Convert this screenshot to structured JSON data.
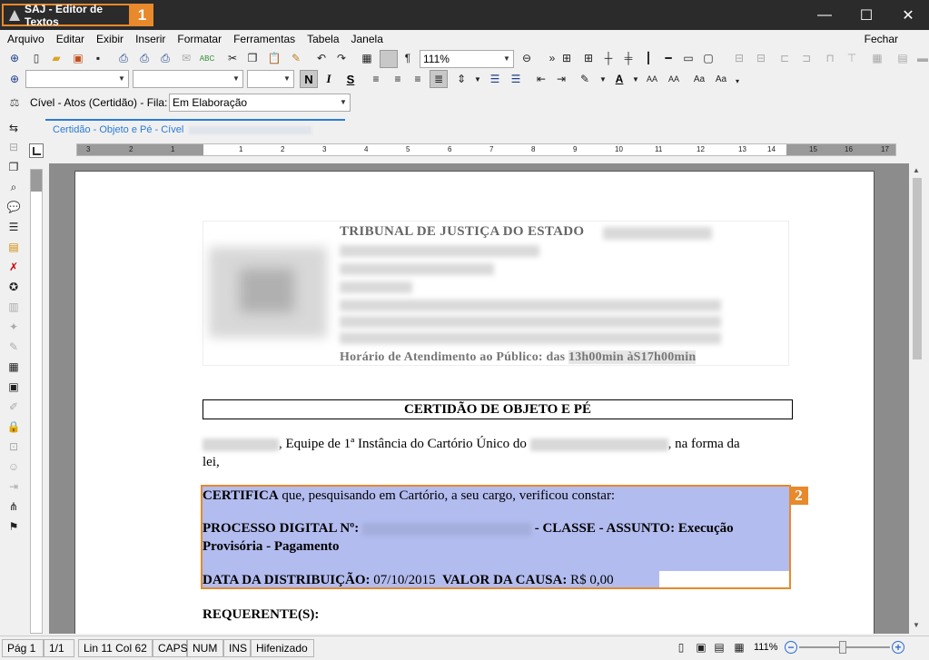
{
  "window": {
    "title": "SAJ - Editor de Textos",
    "badge1": "1",
    "minimize": "—",
    "maximize": "☐",
    "close": "✕"
  },
  "menu": {
    "items": [
      "Arquivo",
      "Editar",
      "Exibir",
      "Inserir",
      "Formatar",
      "Ferramentas",
      "Tabela",
      "Janela"
    ],
    "right": "Fechar"
  },
  "toolbar": {
    "zoom_value": "111%",
    "font_name": "",
    "font_size": "",
    "bold": "N",
    "italic": "I",
    "strike": "S"
  },
  "filter_bar": {
    "label": "Cível - Atos (Certidão) - Fila:",
    "queue_value": "Em Elaboração"
  },
  "tab": {
    "label": "Certidão - Objeto e Pé - Cível"
  },
  "ruler": {
    "numbers": [
      "3",
      "2",
      "1",
      "1",
      "2",
      "3",
      "4",
      "5",
      "6",
      "7",
      "8",
      "9",
      "10",
      "11",
      "12",
      "13",
      "14",
      "15",
      "16",
      "17"
    ]
  },
  "document": {
    "court_title": "TRIBUNAL DE JUSTIÇA DO ESTADO",
    "hours_prefix": "Horário de Atendimento ao Público: das ",
    "hours_value": "13h00min àS17h00min",
    "cert_title": "CERTIDÃO DE OBJETO E PÉ",
    "p1_team": ", Equipe de 1ª Instância do Cartório Único do",
    "p1_tail": ", na forma da",
    "p1_line2": "lei,",
    "certifica_bold": "CERTIFICA",
    "certifica_rest": " que, pesquisando em Cartório, a seu cargo, verificou constar:",
    "processo_label": "PROCESSO DIGITAL Nº:",
    "processo_rest": " - CLASSE - ASSUNTO: Execução",
    "processo_line2": "Provisória - Pagamento",
    "data_label": "DATA DA DISTRIBUIÇÃO:",
    "data_value": " 07/10/2015",
    "valor_label": "VALOR DA CAUSA:",
    "valor_value": " R$ 0,00",
    "requerente": "REQUERENTE(S):",
    "badge2": "2"
  },
  "status": {
    "page": "Pág 1",
    "pages": "1/1",
    "position": "Lin 11  Col 62",
    "caps": "CAPS",
    "num": "NUM",
    "ins": "INS",
    "hyphen": "Hifenizado",
    "zoom": "111%"
  }
}
